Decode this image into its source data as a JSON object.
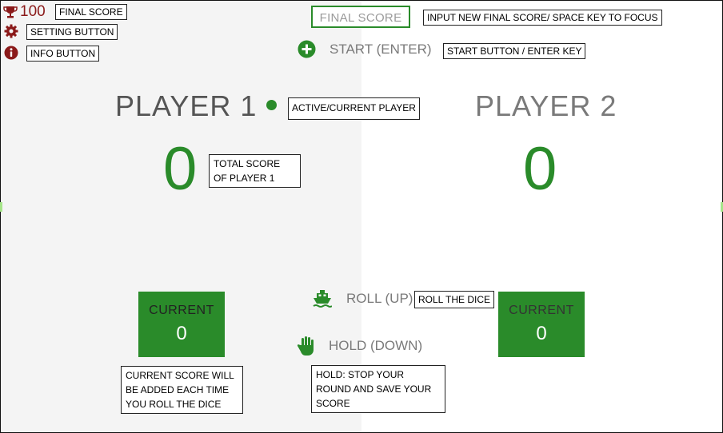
{
  "top": {
    "final_score_value": "100"
  },
  "annotations": {
    "final_score": "FINAL SCORE",
    "setting_button": "SETTING BUTTON",
    "info_button": "INFO BUTTON",
    "input_note": "INPUT NEW FINAL SCORE/ SPACE KEY TO FOCUS",
    "start_note": "START BUTTON / ENTER KEY",
    "active_note": "ACTIVE/CURRENT PLAYER",
    "total_note": "TOTAL SCORE OF PLAYER 1",
    "roll_note": "ROLL THE DICE",
    "current_note": "CURRENT SCORE WILL BE ADDED EACH TIME YOU ROLL THE DICE",
    "hold_note": "HOLD: STOP YOUR ROUND AND SAVE YOUR SCORE"
  },
  "input": {
    "placeholder": "FINAL SCORE"
  },
  "controls": {
    "start": "START (ENTER)",
    "roll": "ROLL (UP)",
    "hold": "HOLD (DOWN)"
  },
  "players": [
    {
      "name": "PLAYER 1",
      "total": "0",
      "current_label": "CURRENT",
      "current": "0"
    },
    {
      "name": "PLAYER 2",
      "total": "0",
      "current_label": "CURRENT",
      "current": "0"
    }
  ],
  "colors": {
    "accent": "#2a8b2a",
    "trophy": "#8b1a1a",
    "left_panel": "#f4f4f4"
  },
  "icons": [
    "trophy-icon",
    "gear-icon",
    "info-icon",
    "plus-circle-icon",
    "active-dot-icon",
    "boat-icon",
    "hand-icon"
  ]
}
